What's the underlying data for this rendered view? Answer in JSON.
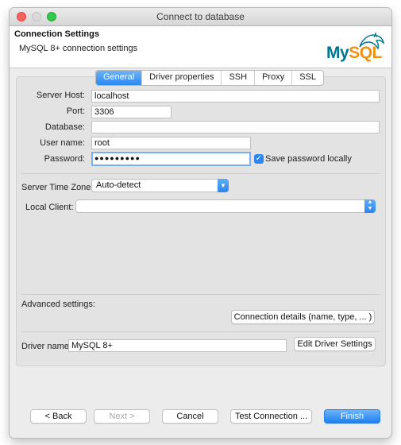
{
  "window": {
    "title": "Connect to database"
  },
  "header": {
    "title": "Connection Settings",
    "subtitle": "MySQL 8+ connection settings",
    "logo": {
      "part1": "My",
      "part2": "SQL",
      "icon": "dolphin-icon"
    }
  },
  "tabs": [
    {
      "label": "General",
      "active": true
    },
    {
      "label": "Driver properties"
    },
    {
      "label": "SSH"
    },
    {
      "label": "Proxy"
    },
    {
      "label": "SSL"
    }
  ],
  "form": {
    "server_host": {
      "label": "Server Host:",
      "value": "localhost"
    },
    "port": {
      "label": "Port:",
      "value": "3306"
    },
    "database": {
      "label": "Database:",
      "value": ""
    },
    "user_name": {
      "label": "User name:",
      "value": "root"
    },
    "password": {
      "label": "Password:",
      "value": "●●●●●●●●●"
    },
    "save_password": {
      "label": "Save password locally",
      "checked": true
    },
    "server_time_zone": {
      "label": "Server Time Zone:",
      "value": "Auto-detect"
    },
    "local_client": {
      "label": "Local Client:",
      "value": ""
    }
  },
  "advanced": {
    "label": "Advanced settings:",
    "button": "Connection details (name, type, ... )"
  },
  "driver": {
    "label": "Driver name:",
    "value": "MySQL 8+",
    "button": "Edit Driver Settings"
  },
  "footer": {
    "back": "< Back",
    "next": "Next >",
    "cancel": "Cancel",
    "test": "Test Connection ...",
    "finish": "Finish"
  },
  "colors": {
    "accent": "#2b88f2",
    "mysql_blue": "#00758f",
    "mysql_orange": "#f29111"
  }
}
